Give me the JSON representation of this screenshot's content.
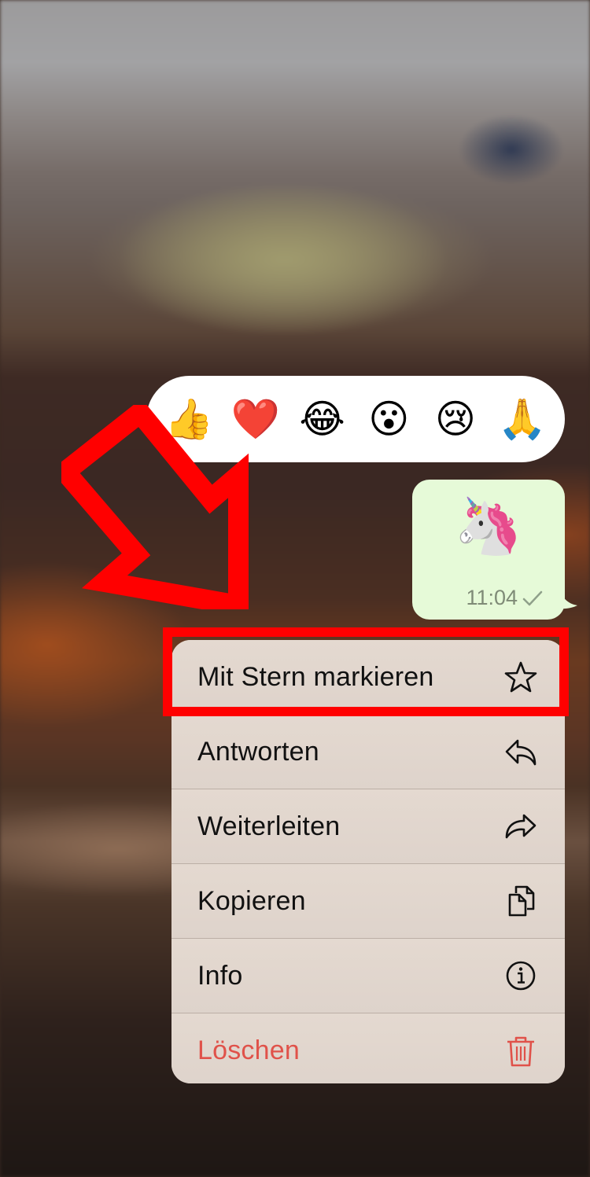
{
  "reactions": [
    {
      "name": "thumbs-up",
      "glyph": "👍"
    },
    {
      "name": "red-heart",
      "glyph": "❤️"
    },
    {
      "name": "tears-of-joy",
      "glyph": "😂"
    },
    {
      "name": "surprised-face",
      "glyph": "😮"
    },
    {
      "name": "crying-face",
      "glyph": "😢"
    },
    {
      "name": "folded-hands",
      "glyph": "🙏"
    }
  ],
  "message": {
    "content": "🦄",
    "content_name": "unicorn-sticker",
    "time": "11:04",
    "status": "sent-single-check",
    "bubble_color": "#e6fad8"
  },
  "context_menu": {
    "items": [
      {
        "label": "Mit Stern markieren",
        "icon": "star-icon",
        "highlighted": true
      },
      {
        "label": "Antworten",
        "icon": "reply-icon"
      },
      {
        "label": "Weiterleiten",
        "icon": "forward-icon"
      },
      {
        "label": "Kopieren",
        "icon": "copy-icon"
      },
      {
        "label": "Info",
        "icon": "info-icon"
      },
      {
        "label": "Löschen",
        "icon": "trash-icon",
        "destructive": true
      }
    ],
    "destructive_color": "#e0524a"
  },
  "annotation": {
    "color": "#ff0000",
    "target": "Mit Stern markieren"
  }
}
